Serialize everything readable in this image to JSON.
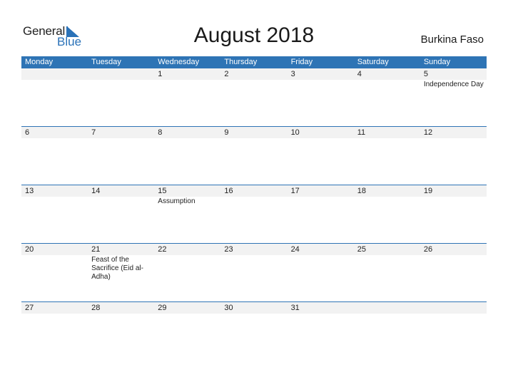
{
  "logo": {
    "general": "General",
    "blue": "Blue"
  },
  "title": "August 2018",
  "country": "Burkina Faso",
  "colors": {
    "header_bg": "#2e74b5",
    "date_strip_bg": "#f2f2f2",
    "accent": "#2a72b8"
  },
  "weekdays": [
    "Monday",
    "Tuesday",
    "Wednesday",
    "Thursday",
    "Friday",
    "Saturday",
    "Sunday"
  ],
  "weeks": [
    {
      "days": [
        {
          "num": "",
          "event": ""
        },
        {
          "num": "",
          "event": ""
        },
        {
          "num": "1",
          "event": ""
        },
        {
          "num": "2",
          "event": ""
        },
        {
          "num": "3",
          "event": ""
        },
        {
          "num": "4",
          "event": ""
        },
        {
          "num": "5",
          "event": "Independence Day"
        }
      ]
    },
    {
      "days": [
        {
          "num": "6",
          "event": ""
        },
        {
          "num": "7",
          "event": ""
        },
        {
          "num": "8",
          "event": ""
        },
        {
          "num": "9",
          "event": ""
        },
        {
          "num": "10",
          "event": ""
        },
        {
          "num": "11",
          "event": ""
        },
        {
          "num": "12",
          "event": ""
        }
      ]
    },
    {
      "days": [
        {
          "num": "13",
          "event": ""
        },
        {
          "num": "14",
          "event": ""
        },
        {
          "num": "15",
          "event": "Assumption"
        },
        {
          "num": "16",
          "event": ""
        },
        {
          "num": "17",
          "event": ""
        },
        {
          "num": "18",
          "event": ""
        },
        {
          "num": "19",
          "event": ""
        }
      ]
    },
    {
      "days": [
        {
          "num": "20",
          "event": ""
        },
        {
          "num": "21",
          "event": "Feast of the Sacrifice (Eid al-Adha)"
        },
        {
          "num": "22",
          "event": ""
        },
        {
          "num": "23",
          "event": ""
        },
        {
          "num": "24",
          "event": ""
        },
        {
          "num": "25",
          "event": ""
        },
        {
          "num": "26",
          "event": ""
        }
      ]
    },
    {
      "days": [
        {
          "num": "27",
          "event": ""
        },
        {
          "num": "28",
          "event": ""
        },
        {
          "num": "29",
          "event": ""
        },
        {
          "num": "30",
          "event": ""
        },
        {
          "num": "31",
          "event": ""
        },
        {
          "num": "",
          "event": ""
        },
        {
          "num": "",
          "event": ""
        }
      ]
    }
  ]
}
